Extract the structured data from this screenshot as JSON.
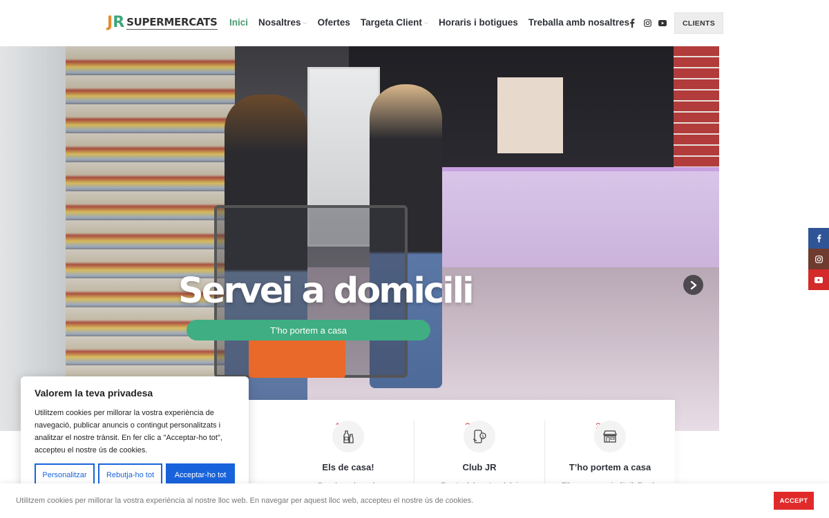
{
  "header": {
    "logo_mark_j": "J",
    "logo_mark_r": "R",
    "logo_text": "SUPERMERCATS",
    "nav": [
      {
        "label": "Inici",
        "active": true,
        "has_dropdown": false
      },
      {
        "label": "Nosaltres",
        "active": false,
        "has_dropdown": true
      },
      {
        "label": "Ofertes",
        "active": false,
        "has_dropdown": false
      },
      {
        "label": "Targeta Client",
        "active": false,
        "has_dropdown": true
      },
      {
        "label": "Horaris i botigues",
        "active": false,
        "has_dropdown": false
      },
      {
        "label": "Treballa amb nosaltres",
        "active": false,
        "has_dropdown": false
      }
    ],
    "social_icons": [
      "facebook-icon",
      "instagram-icon",
      "youtube-icon"
    ],
    "clients_label": "CLIENTS"
  },
  "hero": {
    "title": "Servei a domicili",
    "button_label": "T'ho portem a casa",
    "next_arrow": "›"
  },
  "features": [
    {
      "num": "1.",
      "title": "Els de casa!",
      "desc": "Som la cadena de",
      "icon": "bottles-icon"
    },
    {
      "num": "2.",
      "title": "Club JR",
      "desc": "Fes-te del nostre club i",
      "icon": "phone-coin-icon"
    },
    {
      "num": "3.",
      "title": "T’ho portem a casa",
      "desc": "T’ho posem més fàcil. Fes la",
      "icon": "store-icon"
    }
  ],
  "side_social": [
    {
      "icon": "facebook-icon",
      "color": "#2f5597"
    },
    {
      "icon": "instagram-icon",
      "color": "#6e3b2e"
    },
    {
      "icon": "youtube-icon",
      "color": "#d42a2a"
    }
  ],
  "cookie_modal": {
    "title": "Valorem la teva privadesa",
    "text": "Utilitzem cookies per millorar la vostra experiència de navegació, publicar anuncis o contingut personalitzats i analitzar el nostre trànsit. En fer clic a \"Acceptar-ho tot\", accepteu el nostre ús de cookies.",
    "customize": "Personalitzar",
    "reject": "Rebutja-ho tot",
    "accept_all": "Acceptar-ho tot"
  },
  "cookie_bar": {
    "message": "Utilitzem cookies per millorar la vostra experiència al nostre lloc web. En navegar per aquest lloc web, accepteu el nostre ús de cookies.",
    "accept": "ACCEPT"
  },
  "colors": {
    "brand_green": "#3fae82",
    "active_nav": "#4a9a6e",
    "cookie_blue": "#1863dc",
    "accept_red": "#e02a2a"
  }
}
